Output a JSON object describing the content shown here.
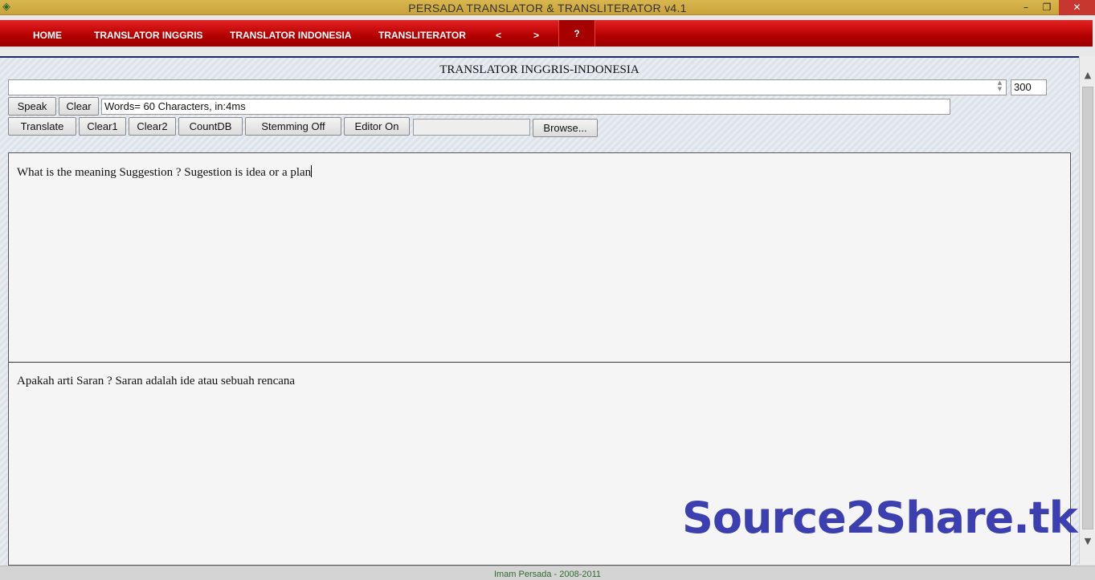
{
  "window": {
    "title": "PERSADA TRANSLATOR & TRANSLITERATOR v4.1",
    "minimize_glyph": "–",
    "maximize_glyph": "❐",
    "close_glyph": "✕"
  },
  "nav": {
    "home": "HOME",
    "translator_inggris": "TRANSLATOR INGGRIS",
    "translator_indonesia": "TRANSLATOR INDONESIA",
    "transliterator": "TRANSLITERATOR",
    "prev": "<",
    "next": ">",
    "help": "?"
  },
  "heading": "TRANSLATOR INGGRIS-INDONESIA",
  "toolbar": {
    "top_input_value": "",
    "limit_value": "300",
    "speak": "Speak",
    "clear": "Clear",
    "status": "Words= 60 Characters, in:4ms",
    "translate": "Translate",
    "clear1": "Clear1",
    "clear2": "Clear2",
    "countdb": "CountDB",
    "stemming": "Stemming Off",
    "editor": "Editor On",
    "file_path": "",
    "browse": "Browse..."
  },
  "source_text": "What is the meaning Suggestion ? Sugestion is idea or a plan",
  "target_text": "Apakah arti Saran ? Saran adalah ide atau sebuah rencana",
  "watermark": "Source2Share.tk",
  "footer": "Imam Persada - 2008-2011",
  "icons": {
    "app": "app-icon",
    "scroll_up": "▲",
    "scroll_down": "▼"
  },
  "colors": {
    "nav_red": "#c40000",
    "title_gold": "#d4b048",
    "watermark_blue": "#3b3fb0",
    "footer_green": "#2e6b2e"
  }
}
